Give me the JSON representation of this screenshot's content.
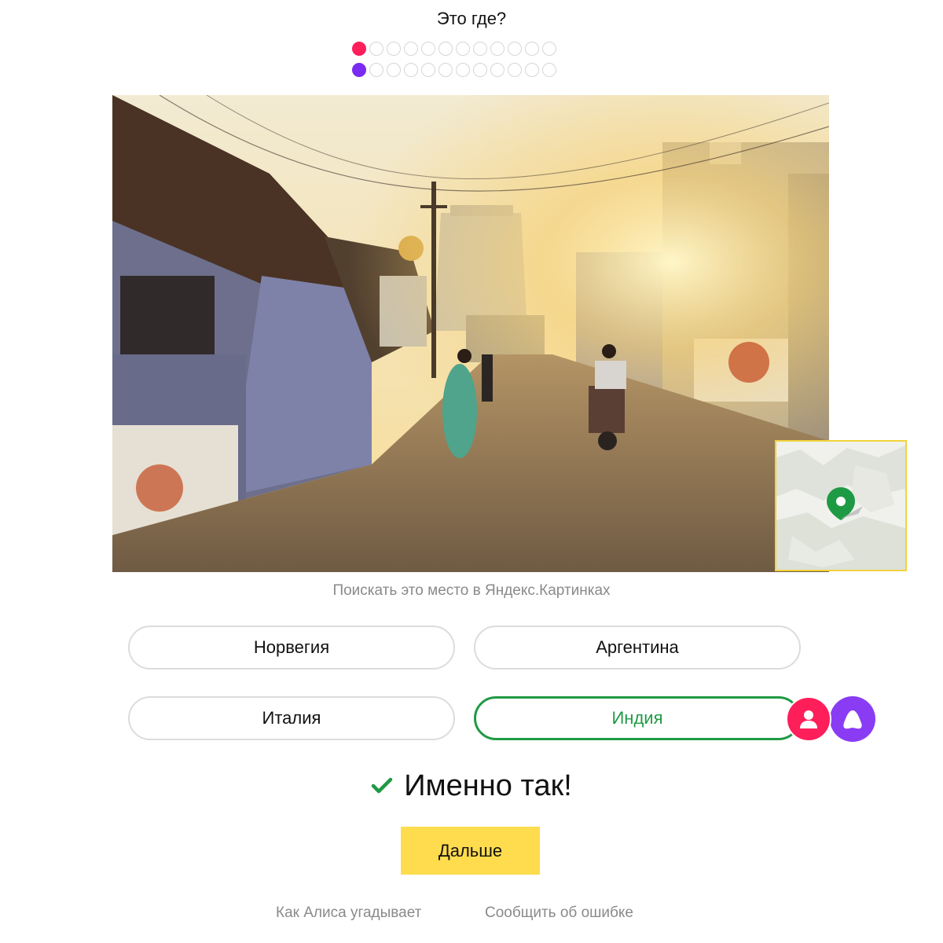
{
  "header": {
    "title": "Это где?"
  },
  "progress": {
    "user_row": {
      "total": 12,
      "current": 1,
      "active_color": "#fe1f5a"
    },
    "alice_row": {
      "total": 12,
      "current": 1,
      "active_color": "#7b2cf2"
    }
  },
  "search_link": "Поискать это место в Яндекс.Картинках",
  "options": [
    {
      "label": "Норвегия",
      "state": "default"
    },
    {
      "label": "Аргентина",
      "state": "default"
    },
    {
      "label": "Италия",
      "state": "default"
    },
    {
      "label": "Индия",
      "state": "correct"
    }
  ],
  "answer_badges": {
    "user_icon": "user-icon",
    "alice_icon": "alice-icon"
  },
  "result": {
    "text": "Именно так!",
    "icon": "checkmark-icon",
    "color": "#1f9a44"
  },
  "next_button": {
    "label": "Дальше",
    "color": "#fedc4d"
  },
  "footer": {
    "how_alice_guesses": "Как Алиса угадывает",
    "report_error": "Сообщить об ошибке"
  }
}
